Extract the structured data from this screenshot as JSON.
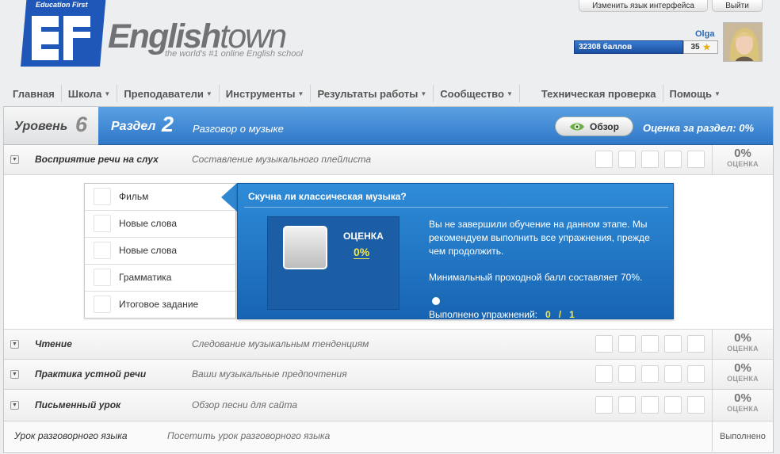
{
  "top_buttons": {
    "language": "Изменить язык интерфейса",
    "exit": "Выйти"
  },
  "brand": {
    "logo_text": "Education First",
    "title_bold": "English",
    "title_light": "town",
    "tagline": "the world's #1 online English school"
  },
  "user": {
    "name": "Olga",
    "points": "32308 баллов",
    "level_badge": "35",
    "star_icon": "star-icon"
  },
  "nav": [
    {
      "label": "Главная",
      "dropdown": false
    },
    {
      "label": "Школа",
      "dropdown": true
    },
    {
      "label": "Преподаватели",
      "dropdown": true
    },
    {
      "label": "Инструменты",
      "dropdown": true
    },
    {
      "label": "Результаты работы",
      "dropdown": true
    },
    {
      "label": "Сообщество",
      "dropdown": true
    },
    {
      "label": "Техническая проверка",
      "dropdown": false
    },
    {
      "label": "Помощь",
      "dropdown": true
    }
  ],
  "header": {
    "level_label": "Уровень",
    "level_number": "6",
    "unit_label": "Раздел",
    "unit_number": "2",
    "unit_title": "Разговор о музыке",
    "overview_button": "Обзор",
    "unit_score": "Оценка за раздел: 0%"
  },
  "sections": [
    {
      "name": "Восприятие речи на слух",
      "desc": "Составление музыкального плейлиста",
      "pct": "0%",
      "pct_label": "ОЦЕНКА"
    },
    {
      "name": "Чтение",
      "desc": "Следование музыкальным тенденциям",
      "pct": "0%",
      "pct_label": "ОЦЕНКА"
    },
    {
      "name": "Практика устной речи",
      "desc": "Ваши музыкальные предпочтения",
      "pct": "0%",
      "pct_label": "ОЦЕНКА"
    },
    {
      "name": "Письменный урок",
      "desc": "Обзор песни для сайта",
      "pct": "0%",
      "pct_label": "ОЦЕНКА"
    }
  ],
  "lessons": [
    "Фильм",
    "Новые слова",
    "Новые слова",
    "Грамматика",
    "Итоговое задание"
  ],
  "detail": {
    "title": "Скучна ли классическая музыка?",
    "score_label": "ОЦЕНКА",
    "score_value": "0%",
    "message": "Вы не завершили обучение на данном этапе. Мы рекомендуем выполнить все упражнения, прежде чем продолжить.",
    "min_score": " Минимальный проходной балл составляет 70%.",
    "done_label": "Выполнено упражнений:",
    "done_count": "0",
    "done_sep": "/",
    "done_total": "1"
  },
  "conversation": {
    "name": "Урок разговорного языка",
    "desc": "Посетить урок разговорного языка",
    "status": "Выполнено"
  }
}
